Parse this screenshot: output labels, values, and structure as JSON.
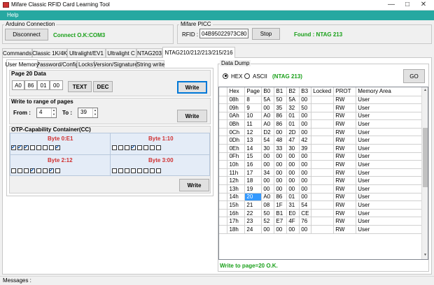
{
  "window": {
    "title": "Mifare Classic RFID Card Learning Tool"
  },
  "menu": {
    "help": "Help"
  },
  "arduino": {
    "group_label": "Arduino Connection",
    "disconnect_label": "Disconnect",
    "status": "Connect O.K:COM3"
  },
  "picc": {
    "group_label": "Mifare  PICC",
    "rfid_label": "RFID :",
    "rfid_value": "04B95022973C80",
    "stop_label": "Stop",
    "found_status": "Found : NTAG 213"
  },
  "tabs": [
    {
      "label": "Commands"
    },
    {
      "label": "Classic 1K/4K"
    },
    {
      "label": "Ultralight/EV1"
    },
    {
      "label": "Ultralight C"
    },
    {
      "label": "NTAG203"
    },
    {
      "label": "NTAG210/212/213/215/216"
    }
  ],
  "subtabs": [
    {
      "label": "User Memory"
    },
    {
      "label": "Password/Config"
    },
    {
      "label": "Locks"
    },
    {
      "label": "Version/Signature"
    },
    {
      "label": "String write"
    }
  ],
  "page20": {
    "title": "Page 20 Data",
    "bytes": [
      "A0",
      "86",
      "01",
      "00"
    ],
    "text_label": "TEXT",
    "dec_label": "DEC",
    "write_label": "Write"
  },
  "range": {
    "title": "Write to range of pages",
    "from_label": "From :",
    "from_value": "4",
    "to_label": "To :",
    "to_value": "39",
    "write_label": "Write"
  },
  "cc": {
    "title": "OTP-Capability Container(CC)",
    "byte0": {
      "label": "Byte 0:E1",
      "bits": [
        1,
        1,
        1,
        0,
        0,
        0,
        0,
        1
      ]
    },
    "byte1": {
      "label": "Byte 1:10",
      "bits": [
        0,
        0,
        0,
        1,
        0,
        0,
        0,
        0
      ]
    },
    "byte2": {
      "label": "Byte 2:12",
      "bits": [
        0,
        0,
        0,
        1,
        0,
        0,
        1,
        0
      ]
    },
    "byte3": {
      "label": "Byte 3:00",
      "bits": [
        0,
        0,
        0,
        0,
        0,
        0,
        0,
        0
      ]
    },
    "write_label": "Write"
  },
  "dump": {
    "group_label": "Data Dump",
    "hex_label": "HEX",
    "ascii_label": "ASCII",
    "mode_status": "(NTAG 213)",
    "go_label": "GO",
    "columns": [
      "Hex",
      "Page",
      "B0",
      "B1",
      "B2",
      "B3",
      "Locked",
      "PROT",
      "Memory Area"
    ],
    "rows": [
      [
        "08h",
        "8",
        "5A",
        "50",
        "5A",
        "00",
        "",
        "RW",
        "User"
      ],
      [
        "09h",
        "9",
        "00",
        "35",
        "32",
        "50",
        "",
        "RW",
        "User"
      ],
      [
        "0Ah",
        "10",
        "A0",
        "86",
        "01",
        "00",
        "",
        "RW",
        "User"
      ],
      [
        "0Bh",
        "11",
        "A0",
        "86",
        "01",
        "00",
        "",
        "RW",
        "User"
      ],
      [
        "0Ch",
        "12",
        "D2",
        "00",
        "2D",
        "00",
        "",
        "RW",
        "User"
      ],
      [
        "0Dh",
        "13",
        "54",
        "48",
        "47",
        "42",
        "",
        "RW",
        "User"
      ],
      [
        "0Eh",
        "14",
        "30",
        "33",
        "30",
        "39",
        "",
        "RW",
        "User"
      ],
      [
        "0Fh",
        "15",
        "00",
        "00",
        "00",
        "00",
        "",
        "RW",
        "User"
      ],
      [
        "10h",
        "16",
        "00",
        "00",
        "00",
        "00",
        "",
        "RW",
        "User"
      ],
      [
        "11h",
        "17",
        "34",
        "00",
        "00",
        "00",
        "",
        "RW",
        "User"
      ],
      [
        "12h",
        "18",
        "00",
        "00",
        "00",
        "00",
        "",
        "RW",
        "User"
      ],
      [
        "13h",
        "19",
        "00",
        "00",
        "00",
        "00",
        "",
        "RW",
        "User"
      ],
      [
        "14h",
        "20",
        "A0",
        "86",
        "01",
        "00",
        "",
        "RW",
        "User"
      ],
      [
        "15h",
        "21",
        "08",
        "1F",
        "31",
        "54",
        "",
        "RW",
        "User"
      ],
      [
        "16h",
        "22",
        "50",
        "B1",
        "E0",
        "CE",
        "",
        "RW",
        "User"
      ],
      [
        "17h",
        "23",
        "52",
        "E7",
        "4F",
        "76",
        "",
        "RW",
        "User"
      ],
      [
        "18h",
        "24",
        "00",
        "00",
        "00",
        "00",
        "",
        "RW",
        "User"
      ]
    ],
    "selected": {
      "row": 12,
      "col": 1
    },
    "status": "Write to page=20 O.K."
  },
  "statusbar": {
    "messages_label": "Messages :"
  },
  "icons": {
    "app": "app-icon",
    "minimize": "minimize-icon",
    "maximize": "maximize-icon",
    "close": "close-icon"
  }
}
